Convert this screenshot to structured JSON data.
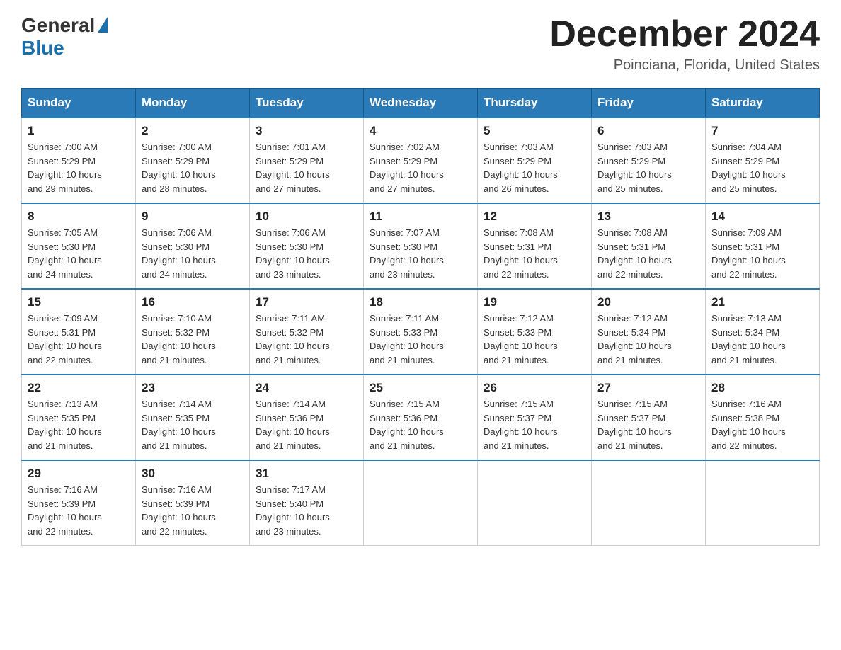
{
  "header": {
    "logo_general": "General",
    "logo_blue": "Blue",
    "month_title": "December 2024",
    "location": "Poinciana, Florida, United States"
  },
  "days_of_week": [
    "Sunday",
    "Monday",
    "Tuesday",
    "Wednesday",
    "Thursday",
    "Friday",
    "Saturday"
  ],
  "weeks": [
    [
      {
        "day": "1",
        "sunrise": "7:00 AM",
        "sunset": "5:29 PM",
        "daylight": "10 hours and 29 minutes."
      },
      {
        "day": "2",
        "sunrise": "7:00 AM",
        "sunset": "5:29 PM",
        "daylight": "10 hours and 28 minutes."
      },
      {
        "day": "3",
        "sunrise": "7:01 AM",
        "sunset": "5:29 PM",
        "daylight": "10 hours and 27 minutes."
      },
      {
        "day": "4",
        "sunrise": "7:02 AM",
        "sunset": "5:29 PM",
        "daylight": "10 hours and 27 minutes."
      },
      {
        "day": "5",
        "sunrise": "7:03 AM",
        "sunset": "5:29 PM",
        "daylight": "10 hours and 26 minutes."
      },
      {
        "day": "6",
        "sunrise": "7:03 AM",
        "sunset": "5:29 PM",
        "daylight": "10 hours and 25 minutes."
      },
      {
        "day": "7",
        "sunrise": "7:04 AM",
        "sunset": "5:29 PM",
        "daylight": "10 hours and 25 minutes."
      }
    ],
    [
      {
        "day": "8",
        "sunrise": "7:05 AM",
        "sunset": "5:30 PM",
        "daylight": "10 hours and 24 minutes."
      },
      {
        "day": "9",
        "sunrise": "7:06 AM",
        "sunset": "5:30 PM",
        "daylight": "10 hours and 24 minutes."
      },
      {
        "day": "10",
        "sunrise": "7:06 AM",
        "sunset": "5:30 PM",
        "daylight": "10 hours and 23 minutes."
      },
      {
        "day": "11",
        "sunrise": "7:07 AM",
        "sunset": "5:30 PM",
        "daylight": "10 hours and 23 minutes."
      },
      {
        "day": "12",
        "sunrise": "7:08 AM",
        "sunset": "5:31 PM",
        "daylight": "10 hours and 22 minutes."
      },
      {
        "day": "13",
        "sunrise": "7:08 AM",
        "sunset": "5:31 PM",
        "daylight": "10 hours and 22 minutes."
      },
      {
        "day": "14",
        "sunrise": "7:09 AM",
        "sunset": "5:31 PM",
        "daylight": "10 hours and 22 minutes."
      }
    ],
    [
      {
        "day": "15",
        "sunrise": "7:09 AM",
        "sunset": "5:31 PM",
        "daylight": "10 hours and 22 minutes."
      },
      {
        "day": "16",
        "sunrise": "7:10 AM",
        "sunset": "5:32 PM",
        "daylight": "10 hours and 21 minutes."
      },
      {
        "day": "17",
        "sunrise": "7:11 AM",
        "sunset": "5:32 PM",
        "daylight": "10 hours and 21 minutes."
      },
      {
        "day": "18",
        "sunrise": "7:11 AM",
        "sunset": "5:33 PM",
        "daylight": "10 hours and 21 minutes."
      },
      {
        "day": "19",
        "sunrise": "7:12 AM",
        "sunset": "5:33 PM",
        "daylight": "10 hours and 21 minutes."
      },
      {
        "day": "20",
        "sunrise": "7:12 AM",
        "sunset": "5:34 PM",
        "daylight": "10 hours and 21 minutes."
      },
      {
        "day": "21",
        "sunrise": "7:13 AM",
        "sunset": "5:34 PM",
        "daylight": "10 hours and 21 minutes."
      }
    ],
    [
      {
        "day": "22",
        "sunrise": "7:13 AM",
        "sunset": "5:35 PM",
        "daylight": "10 hours and 21 minutes."
      },
      {
        "day": "23",
        "sunrise": "7:14 AM",
        "sunset": "5:35 PM",
        "daylight": "10 hours and 21 minutes."
      },
      {
        "day": "24",
        "sunrise": "7:14 AM",
        "sunset": "5:36 PM",
        "daylight": "10 hours and 21 minutes."
      },
      {
        "day": "25",
        "sunrise": "7:15 AM",
        "sunset": "5:36 PM",
        "daylight": "10 hours and 21 minutes."
      },
      {
        "day": "26",
        "sunrise": "7:15 AM",
        "sunset": "5:37 PM",
        "daylight": "10 hours and 21 minutes."
      },
      {
        "day": "27",
        "sunrise": "7:15 AM",
        "sunset": "5:37 PM",
        "daylight": "10 hours and 21 minutes."
      },
      {
        "day": "28",
        "sunrise": "7:16 AM",
        "sunset": "5:38 PM",
        "daylight": "10 hours and 22 minutes."
      }
    ],
    [
      {
        "day": "29",
        "sunrise": "7:16 AM",
        "sunset": "5:39 PM",
        "daylight": "10 hours and 22 minutes."
      },
      {
        "day": "30",
        "sunrise": "7:16 AM",
        "sunset": "5:39 PM",
        "daylight": "10 hours and 22 minutes."
      },
      {
        "day": "31",
        "sunrise": "7:17 AM",
        "sunset": "5:40 PM",
        "daylight": "10 hours and 23 minutes."
      },
      null,
      null,
      null,
      null
    ]
  ],
  "labels": {
    "sunrise": "Sunrise:",
    "sunset": "Sunset:",
    "daylight": "Daylight:"
  }
}
